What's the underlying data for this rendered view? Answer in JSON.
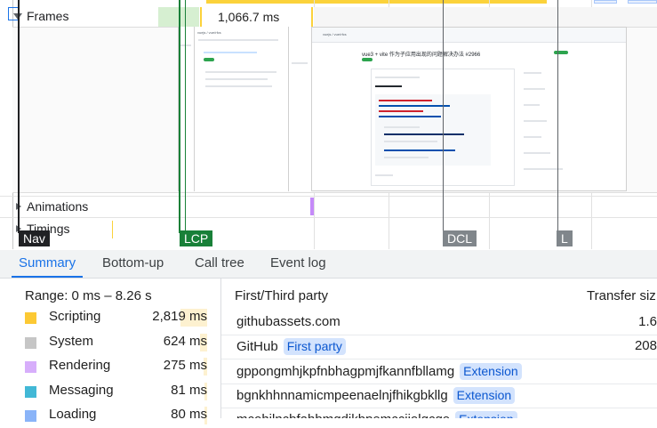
{
  "tracks": {
    "frames_label": "Frames",
    "frame_duration": "1,066.7 ms",
    "animations_label": "Animations",
    "timings_label": "Timings"
  },
  "markers": {
    "nav": "Nav",
    "lcp": "LCP",
    "dcl": "DCL",
    "load": "L"
  },
  "screenshot": {
    "repo_crumb": "vuejs / vue/rfcs",
    "issue_title": "vue3 + vite 作为子应用出现的问题解决办法 #2966",
    "tab_code": "Code",
    "status_open": "Open"
  },
  "tabs": [
    {
      "label": "Summary",
      "active": true
    },
    {
      "label": "Bottom-up",
      "active": false
    },
    {
      "label": "Call tree",
      "active": false
    },
    {
      "label": "Event log",
      "active": false
    }
  ],
  "summary": {
    "range": "Range: 0 ms – 8.26 s",
    "items": [
      {
        "name": "Scripting",
        "value": "2,819 ms",
        "color": "#fcc934",
        "fraction": 0.3
      },
      {
        "name": "System",
        "value": "624 ms",
        "color": "#c6c6c6",
        "fraction": 0.08
      },
      {
        "name": "Rendering",
        "value": "275 ms",
        "color": "#d7aefb",
        "fraction": 0.04
      },
      {
        "name": "Messaging",
        "value": "81 ms",
        "color": "#42b8d6",
        "fraction": 0.02
      },
      {
        "name": "Loading",
        "value": "80 ms",
        "color": "#8ab4f8",
        "fraction": 0.02
      }
    ]
  },
  "third_party": {
    "header_party": "First/Third party",
    "header_transfer": "Transfer siz",
    "rows": [
      {
        "name": "githubassets.com",
        "badge": "",
        "transfer": "1.6"
      },
      {
        "name": "GitHub",
        "badge": "First party",
        "transfer": "208"
      },
      {
        "name": "gppongmhjkpfnbhagpmjfkannfbllamg",
        "badge": "Extension",
        "transfer": ""
      },
      {
        "name": "bgnkhhnnamicmpeenaelnjfhikgbkllg",
        "badge": "Extension",
        "transfer": ""
      },
      {
        "name": "mcohilncbfahbmgdjkbpemcciiolgcge",
        "badge": "Extension",
        "transfer": ""
      }
    ]
  }
}
